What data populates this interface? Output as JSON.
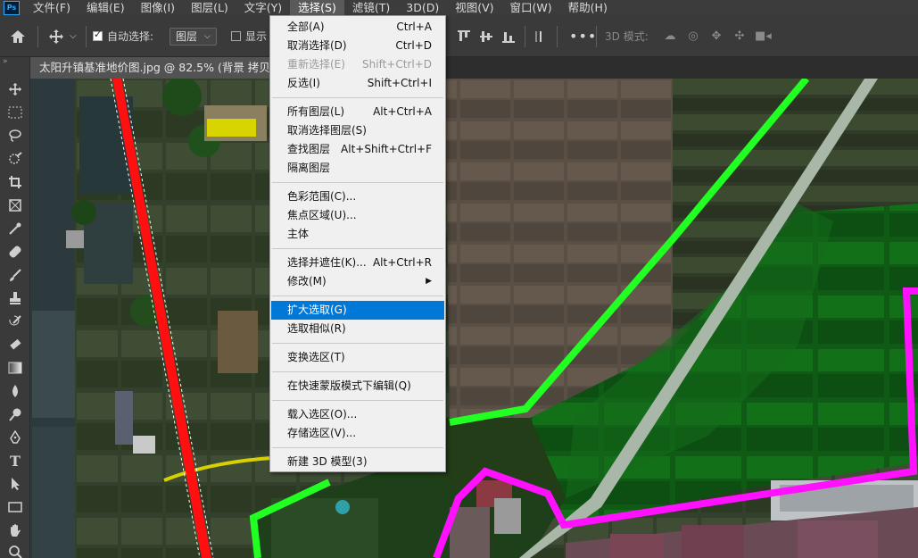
{
  "menubar": {
    "logo": "Ps",
    "items": [
      "文件(F)",
      "编辑(E)",
      "图像(I)",
      "图层(L)",
      "文字(Y)",
      "选择(S)",
      "滤镜(T)",
      "3D(D)",
      "视图(V)",
      "窗口(W)",
      "帮助(H)"
    ],
    "active_index": 5
  },
  "options": {
    "auto_select_label": "自动选择:",
    "auto_select_checked": true,
    "layer_select": "图层",
    "show_label": "显示",
    "mode_label": "3D 模式:"
  },
  "document": {
    "tab_title": "太阳升镇基准地价图.jpg @ 82.5% (背景 拷贝,"
  },
  "dropdown": {
    "groups": [
      [
        {
          "label": "全部(A)",
          "shortcut": "Ctrl+A",
          "disabled": false
        },
        {
          "label": "取消选择(D)",
          "shortcut": "Ctrl+D",
          "disabled": false
        },
        {
          "label": "重新选择(E)",
          "shortcut": "Shift+Ctrl+D",
          "disabled": true
        },
        {
          "label": "反选(I)",
          "shortcut": "Shift+Ctrl+I",
          "disabled": false
        }
      ],
      [
        {
          "label": "所有图层(L)",
          "shortcut": "Alt+Ctrl+A",
          "disabled": false
        },
        {
          "label": "取消选择图层(S)",
          "shortcut": "",
          "disabled": false
        },
        {
          "label": "查找图层",
          "shortcut": "Alt+Shift+Ctrl+F",
          "disabled": false
        },
        {
          "label": "隔离图层",
          "shortcut": "",
          "disabled": false
        }
      ],
      [
        {
          "label": "色彩范围(C)...",
          "shortcut": "",
          "disabled": false
        },
        {
          "label": "焦点区域(U)...",
          "shortcut": "",
          "disabled": false
        },
        {
          "label": "主体",
          "shortcut": "",
          "disabled": false
        }
      ],
      [
        {
          "label": "选择并遮住(K)...",
          "shortcut": "Alt+Ctrl+R",
          "disabled": false
        },
        {
          "label": "修改(M)",
          "shortcut": "",
          "disabled": false,
          "submenu": true
        }
      ],
      [
        {
          "label": "扩大选取(G)",
          "shortcut": "",
          "disabled": false,
          "highlighted": true
        },
        {
          "label": "选取相似(R)",
          "shortcut": "",
          "disabled": false
        }
      ],
      [
        {
          "label": "变换选区(T)",
          "shortcut": "",
          "disabled": false
        }
      ],
      [
        {
          "label": "在快速蒙版模式下编辑(Q)",
          "shortcut": "",
          "disabled": false
        }
      ],
      [
        {
          "label": "载入选区(O)...",
          "shortcut": "",
          "disabled": false
        },
        {
          "label": "存储选区(V)...",
          "shortcut": "",
          "disabled": false
        }
      ],
      [
        {
          "label": "新建 3D 模型(3)",
          "shortcut": "",
          "disabled": false
        }
      ]
    ]
  },
  "colors": {
    "highlight": "#0078d7",
    "boundary_red": "#ff1010",
    "boundary_green": "#22ff22",
    "boundary_magenta": "#ff10ff"
  }
}
